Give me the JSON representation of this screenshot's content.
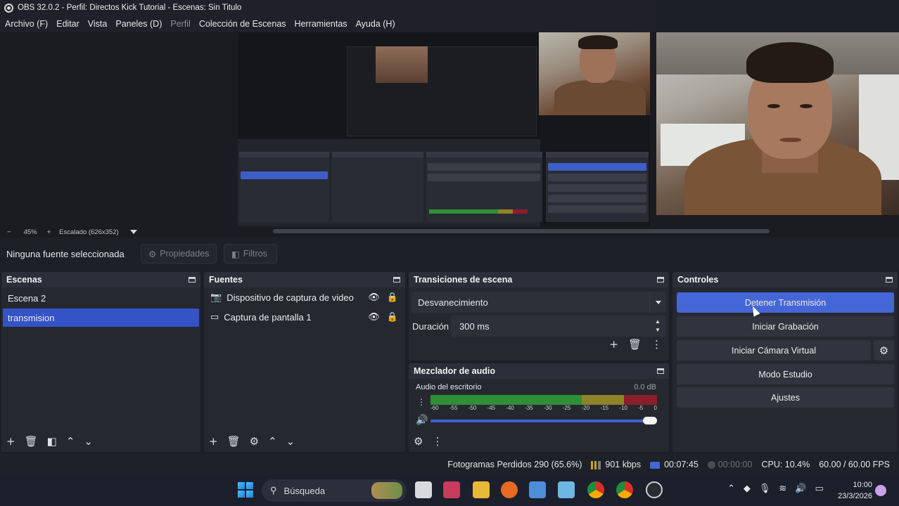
{
  "window": {
    "title": "OBS 32.0.2 - Perfil: Directos Kick Tutorial - Escenas: Sin Titulo"
  },
  "menu": {
    "items": [
      "Archivo (F)",
      "Editar",
      "Vista",
      "Paneles (D)",
      "Perfil",
      "Colección de Escenas",
      "Herramientas",
      "Ayuda (H)"
    ]
  },
  "zoom": {
    "minus": "−",
    "value": "45%",
    "plus": "+",
    "scaling": "Escalado (626x352)"
  },
  "source_toolbar": {
    "no_source": "Ninguna fuente seleccionada",
    "properties": "Propiedades",
    "filters": "Filtros"
  },
  "scenes": {
    "title": "Escenas",
    "items": [
      "Escena 2",
      "transmision"
    ],
    "selected_index": 1
  },
  "sources": {
    "title": "Fuentes",
    "items": [
      {
        "label": "Dispositivo de captura de video",
        "icon": "camera-icon"
      },
      {
        "label": "Captura de pantalla 1",
        "icon": "monitor-icon"
      }
    ]
  },
  "transitions": {
    "title": "Transiciones de escena",
    "selected": "Desvanecimiento",
    "duration_label": "Duración",
    "duration_value": "300 ms"
  },
  "mixer": {
    "title": "Mezclador de audio",
    "channel": "Audio del escritorio",
    "level": "0.0 dB",
    "scale": [
      "-60",
      "-55",
      "-50",
      "-45",
      "-40",
      "-35",
      "-30",
      "-25",
      "-20",
      "-15",
      "-10",
      "-5",
      "0"
    ],
    "volume": 1.0
  },
  "controls": {
    "title": "Controles",
    "stop_stream": "Detener Transmisión",
    "start_recording": "Iniciar Grabación",
    "start_vcam": "Iniciar Cámara Virtual",
    "studio_mode": "Modo Estudio",
    "settings": "Ajustes"
  },
  "status": {
    "dropped": "Fotogramas Perdidos 290 (65.6%)",
    "bitrate": "901 kbps",
    "live_time": "00:07:45",
    "rec_time": "00:00:00",
    "cpu": "CPU: 10.4%",
    "fps": "60.00 / 60.00 FPS"
  },
  "taskbar": {
    "search": "Búsqueda",
    "time": "10:00",
    "date": "23/3/2026"
  },
  "colors": {
    "accent": "#4566d6",
    "selection": "#3453c6",
    "meter_green": "#2f8f36",
    "meter_yellow": "#8e8327",
    "meter_red": "#8c1e2a"
  }
}
